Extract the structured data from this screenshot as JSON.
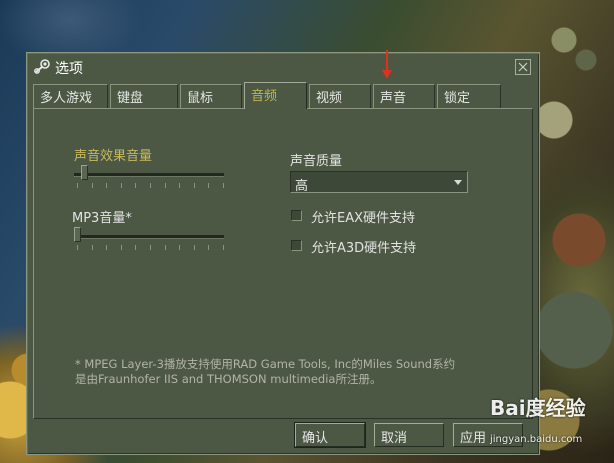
{
  "dialog": {
    "title": "选项",
    "close_icon": "close-icon",
    "logo_icon": "steam-icon"
  },
  "tabs": [
    {
      "label": "多人游戏",
      "active": false
    },
    {
      "label": "键盘",
      "active": false
    },
    {
      "label": "鼠标",
      "active": false
    },
    {
      "label": "音频",
      "active": true
    },
    {
      "label": "视频",
      "active": false
    },
    {
      "label": "声音",
      "active": false
    },
    {
      "label": "锁定",
      "active": false
    }
  ],
  "audio": {
    "effects_volume_label": "声音效果音量",
    "effects_volume_level": 0.05,
    "mp3_volume_label": "MP3音量*",
    "mp3_volume_level": 0.0,
    "quality_label": "声音质量",
    "quality_value": "高",
    "eax_label": "允许EAX硬件支持",
    "eax_checked": false,
    "a3d_label": "允许A3D硬件支持",
    "a3d_checked": false,
    "footnote_line1": "* MPEG Layer-3播放支持使用RAD Game Tools, Inc的Miles Sound系约",
    "footnote_line2": "是由Fraunhofer IIS and THOMSON multimedia所注册。"
  },
  "buttons": {
    "ok": "确认",
    "cancel": "取消",
    "apply": "应用"
  },
  "watermark": {
    "logo_text": "Bai度经验",
    "url": "jingyan.baidu.com"
  },
  "colors": {
    "dialog_bg": "#4c5844",
    "accent_gold": "#c8b95e",
    "annotation_arrow": "#e03020"
  }
}
